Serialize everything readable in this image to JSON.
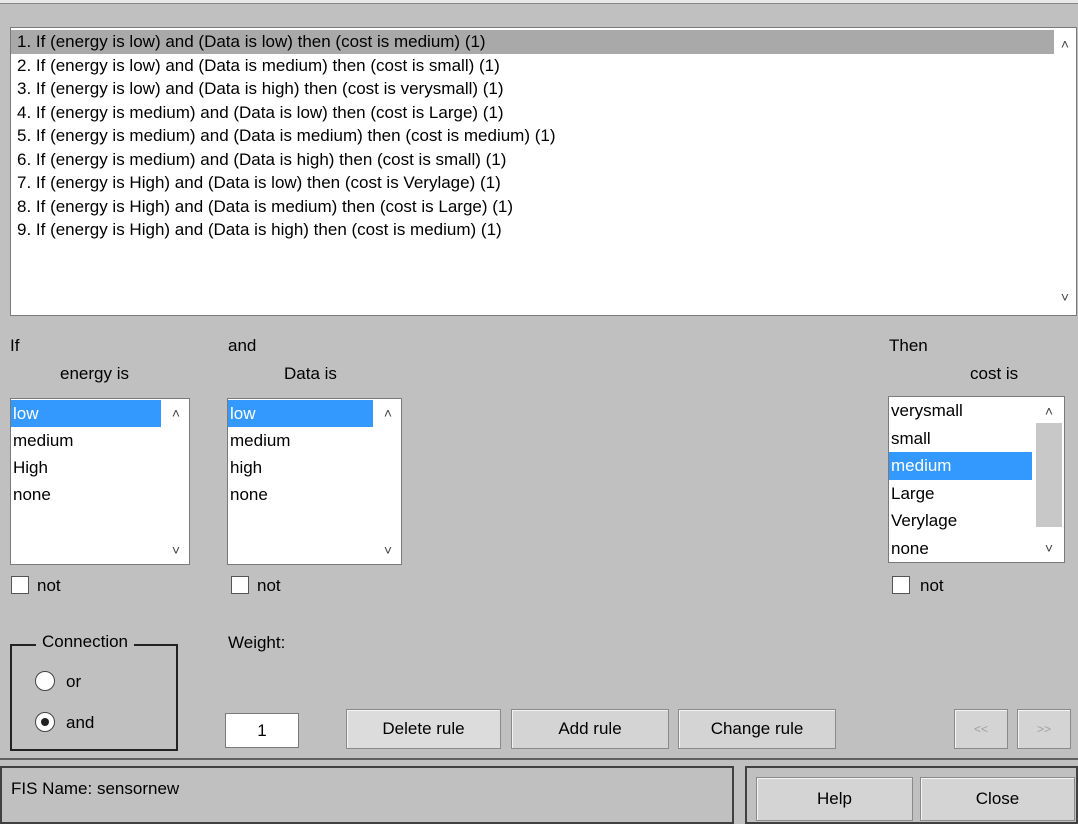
{
  "rules_list": {
    "items": [
      "1. If (energy is low) and (Data is low) then (cost is medium) (1)",
      "2. If (energy is low) and (Data is medium) then (cost is small) (1)",
      "3. If (energy is low) and (Data is high) then (cost is verysmall) (1)",
      "4. If (energy is medium) and (Data is low) then (cost is Large) (1)",
      "5. If (energy is medium) and (Data is medium) then (cost is medium) (1)",
      "6. If (energy is medium) and (Data is high) then (cost is small) (1)",
      "7. If (energy is High) and (Data is low) then (cost is Verylage) (1)",
      "8. If (energy is High) and (Data is medium) then (cost is Large) (1)",
      "9. If (energy is High) and (Data is high) then (cost is medium) (1)"
    ],
    "selected_index": 0
  },
  "input1": {
    "header": "If",
    "title": "energy is",
    "options": [
      "low",
      "medium",
      "High",
      "none"
    ],
    "selected": "low",
    "not_label": "not"
  },
  "input2": {
    "header": "and",
    "title": "Data is",
    "options": [
      "low",
      "medium",
      "high",
      "none"
    ],
    "selected": "low",
    "not_label": "not"
  },
  "output": {
    "header": "Then",
    "title": "cost is",
    "options": [
      "verysmall",
      "small",
      "medium",
      "Large",
      "Verylage",
      "none"
    ],
    "selected": "medium",
    "not_label": "not"
  },
  "connection": {
    "title": "Connection",
    "or_label": "or",
    "and_label": "and",
    "selected": "and"
  },
  "weight": {
    "label": "Weight:",
    "value": "1"
  },
  "buttons": {
    "delete": "Delete rule",
    "add": "Add rule",
    "change": "Change rule",
    "prev": "<<",
    "next": ">>",
    "help": "Help",
    "close": "Close"
  },
  "status": {
    "text": "FIS Name: sensornew"
  },
  "icons": {
    "scroll_up": "chevron-up-icon",
    "scroll_down": "chevron-down-icon",
    "selection_color": "#3399ff",
    "rule_selection_color": "#a9a9a9"
  }
}
